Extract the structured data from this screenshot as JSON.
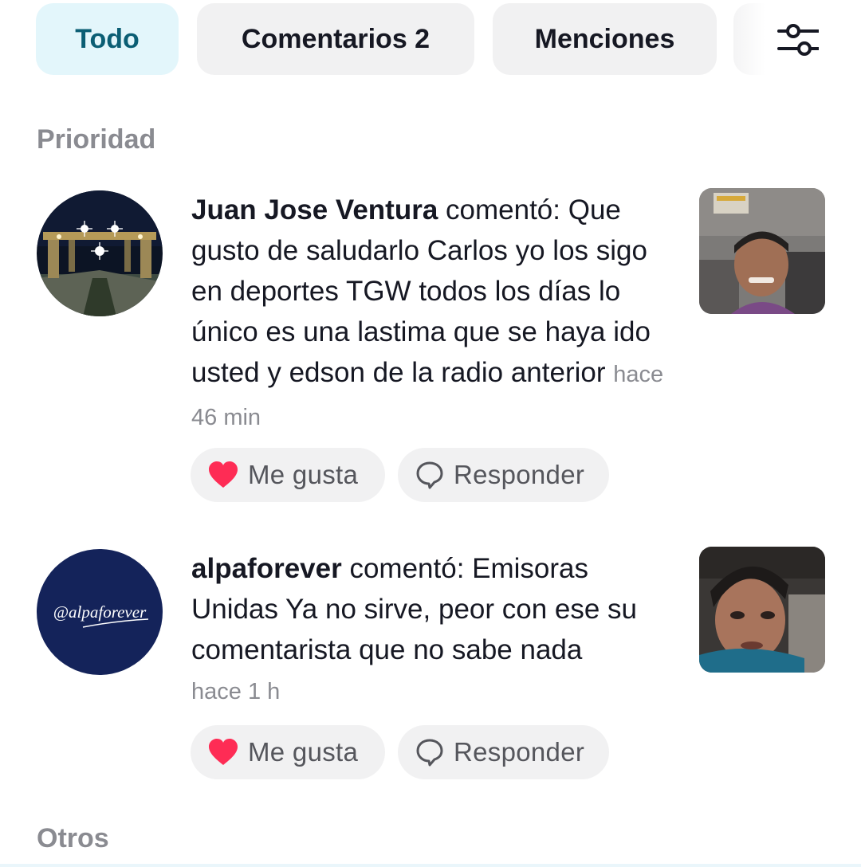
{
  "tabs": [
    {
      "label": "Todo",
      "active": true
    },
    {
      "label": "Comentarios 2",
      "active": false
    },
    {
      "label": "Menciones",
      "active": false
    }
  ],
  "filter_icon": "sliders-icon",
  "sections": {
    "priority": "Prioridad",
    "others": "Otros"
  },
  "notifications": [
    {
      "username": "Juan Jose Ventura",
      "action": "comentó:",
      "comment": "Que gusto de saludarlo Carlos yo los sigo en deportes TGW todos los días lo único es una lastima que se haya ido usted y edson de la radio anterior",
      "time": "hace 46 min",
      "like_label": "Me gusta",
      "reply_label": "Responder"
    },
    {
      "username": "alpaforever",
      "action": "comentó:",
      "comment": "Emisoras Unidas Ya no sirve, peor con ese su comentarista que no sabe nada",
      "time": "hace 1 h",
      "like_label": "Me gusta",
      "reply_label": "Responder",
      "avatar_text": "@alpaforever"
    }
  ],
  "colors": {
    "active_tab_bg": "#e3f6fb",
    "active_tab_text": "#0b5e74",
    "heart": "#fe2c55",
    "muted": "#8a8b91"
  }
}
